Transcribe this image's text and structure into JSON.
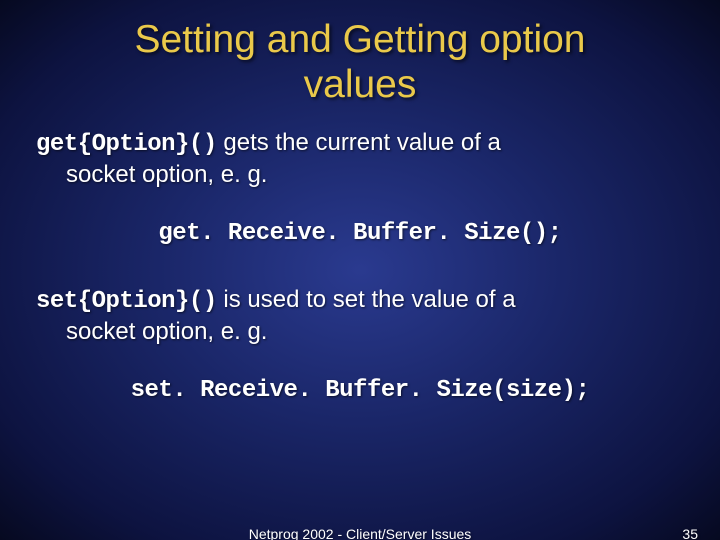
{
  "title_line1": "Setting and Getting option",
  "title_line2": "values",
  "para1_code": "get{Option}()",
  "para1_rest": " gets the current value of a",
  "para1_line2": "socket option, e. g.",
  "code1": "get. Receive. Buffer. Size();",
  "para2_code": "set{Option}()",
  "para2_rest": " is used to set the value of a",
  "para2_line2": "socket option, e. g.",
  "code2": "set. Receive. Buffer. Size(size);",
  "footer_center": "Netprog 2002 - Client/Server Issues",
  "page_number": "35"
}
